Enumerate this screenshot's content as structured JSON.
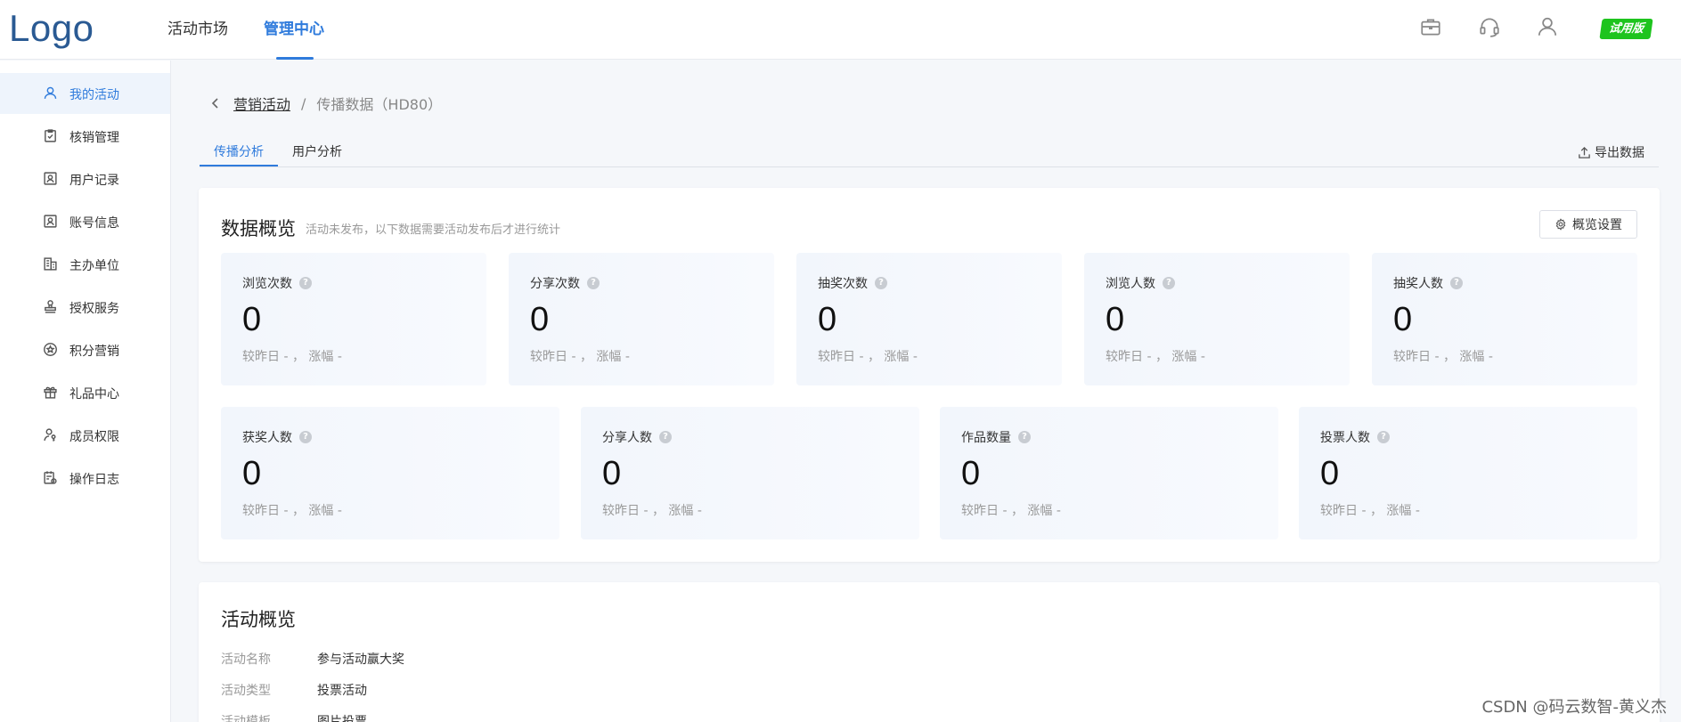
{
  "header": {
    "logo": "Logo",
    "nav": [
      "活动市场",
      "管理中心"
    ],
    "active_nav": 1,
    "icons": [
      "briefcase-icon",
      "headset-icon",
      "user-icon"
    ],
    "trial_badge": "试用版",
    "accent_color": "#2f7bdc",
    "badge_color": "#1ec41e"
  },
  "sidebar": {
    "items": [
      {
        "label": "我的活动",
        "icon": "user-icon",
        "active": true
      },
      {
        "label": "核销管理",
        "icon": "clipboard-check-icon"
      },
      {
        "label": "用户记录",
        "icon": "id-badge-icon"
      },
      {
        "label": "账号信息",
        "icon": "id-card-icon"
      },
      {
        "label": "主办单位",
        "icon": "building-icon"
      },
      {
        "label": "授权服务",
        "icon": "stamp-icon"
      },
      {
        "label": "积分营销",
        "icon": "star-circle-icon"
      },
      {
        "label": "礼品中心",
        "icon": "gift-icon"
      },
      {
        "label": "成员权限",
        "icon": "user-key-icon"
      },
      {
        "label": "操作日志",
        "icon": "calendar-log-icon"
      }
    ]
  },
  "breadcrumb": {
    "parent": "营销活动",
    "separator": "/",
    "current": "传播数据（HD80）"
  },
  "tabs": {
    "items": [
      "传播分析",
      "用户分析"
    ],
    "export_label": "导出数据"
  },
  "overview": {
    "title": "数据概览",
    "subtitle": "活动未发布，以下数据需要活动发布后才进行统计",
    "settings_label": "概览设置",
    "row1": [
      {
        "label": "浏览次数",
        "value": "0",
        "compare": "较昨日 - ， 涨幅 -"
      },
      {
        "label": "分享次数",
        "value": "0",
        "compare": "较昨日 - ， 涨幅 -"
      },
      {
        "label": "抽奖次数",
        "value": "0",
        "compare": "较昨日 - ， 涨幅 -"
      },
      {
        "label": "浏览人数",
        "value": "0",
        "compare": "较昨日 - ， 涨幅 -"
      },
      {
        "label": "抽奖人数",
        "value": "0",
        "compare": "较昨日 - ， 涨幅 -"
      }
    ],
    "row2": [
      {
        "label": "获奖人数",
        "value": "0",
        "compare": "较昨日 - ， 涨幅 -"
      },
      {
        "label": "分享人数",
        "value": "0",
        "compare": "较昨日 - ， 涨幅 -"
      },
      {
        "label": "作品数量",
        "value": "0",
        "compare": "较昨日 - ， 涨幅 -"
      },
      {
        "label": "投票人数",
        "value": "0",
        "compare": "较昨日 - ， 涨幅 -"
      }
    ]
  },
  "activity": {
    "title": "活动概览",
    "rows": [
      {
        "key": "活动名称",
        "value": "参与活动赢大奖"
      },
      {
        "key": "活动类型",
        "value": "投票活动"
      },
      {
        "key": "活动模板",
        "value": "图片投票"
      }
    ]
  },
  "watermark": "CSDN @码云数智-黄义杰"
}
